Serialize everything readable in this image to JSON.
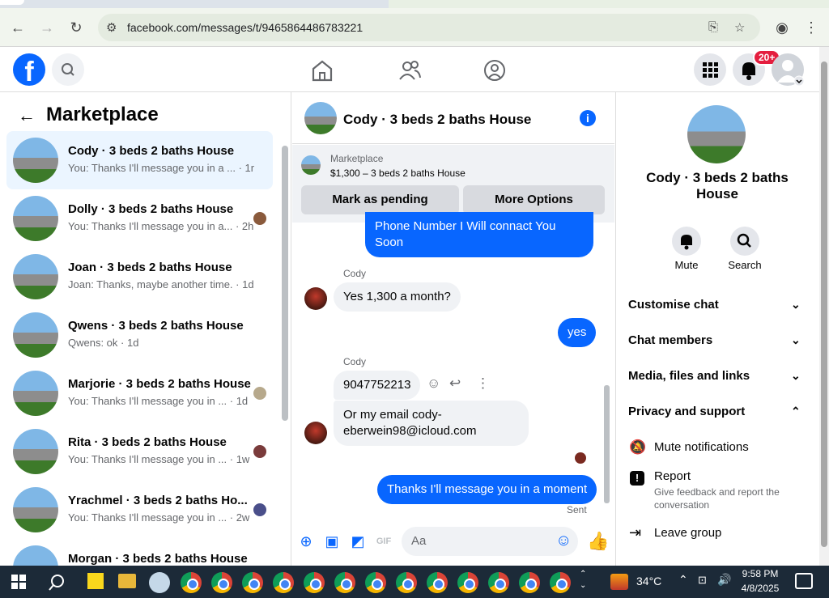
{
  "browser": {
    "url": "facebook.com/messages/t/9465864486783221"
  },
  "topbar": {
    "notifications_badge": "20+"
  },
  "left_panel": {
    "title": "Marketplace",
    "conversations": [
      {
        "title": "Cody · 3 beds 2 baths House",
        "preview": "You: Thanks I'll message you in a ... · 1m",
        "active": true
      },
      {
        "title": "Dolly · 3 beds 2 baths House",
        "preview": "You: Thanks I'll message you in a... · 2h"
      },
      {
        "title": "Joan · 3 beds 2 baths House",
        "preview": "Joan: Thanks, maybe another time. · 1d"
      },
      {
        "title": "Qwens · 3 beds 2 baths House",
        "preview": "Qwens: ok · 1d"
      },
      {
        "title": "Marjorie · 3 beds 2 baths House",
        "preview": "You: Thanks I'll message you in ... · 1d"
      },
      {
        "title": "Rita · 3 beds 2 baths House",
        "preview": "You: Thanks I'll message you in ... · 1w"
      },
      {
        "title": "Yrachmel · 3 beds 2 baths Ho...",
        "preview": "You: Thanks I'll message you in ... · 2w"
      },
      {
        "title": "Morgan · 3 beds 2 baths House",
        "preview": ""
      }
    ]
  },
  "chat": {
    "title": "Cody · 3 beds 2 baths House",
    "marketplace_label": "Marketplace",
    "listing_price": "$1,300 – 3 beds 2 baths House",
    "mark_pending_label": "Mark as pending",
    "more_options_label": "More Options",
    "messages": {
      "m1": "Phone Number I Will connact You Soon",
      "sender1": "Cody",
      "m2": "Yes 1,300 a month?",
      "m3": "yes",
      "sender2": "Cody",
      "m4": "9047752213",
      "m5": "Or my email cody­eberwein98@icloud.com",
      "m6": "Thanks I'll message you in a moment",
      "status": "Sent"
    },
    "composer_placeholder": "Aa"
  },
  "right_panel": {
    "name": "Cody · 3 beds 2 baths House",
    "mute_label": "Mute",
    "search_label": "Search",
    "sections": [
      "Customise chat",
      "Chat members",
      "Media, files and links",
      "Privacy and support"
    ],
    "mute_notifications": "Mute notifications",
    "report": "Report",
    "report_desc": "Give feedback and report the conversation",
    "leave_group": "Leave group"
  },
  "taskbar": {
    "temperature": "34°C",
    "time": "9:58 PM",
    "date": "4/8/2025"
  },
  "colors": {
    "accent": "#0866ff",
    "badge": "#e41e3f"
  }
}
